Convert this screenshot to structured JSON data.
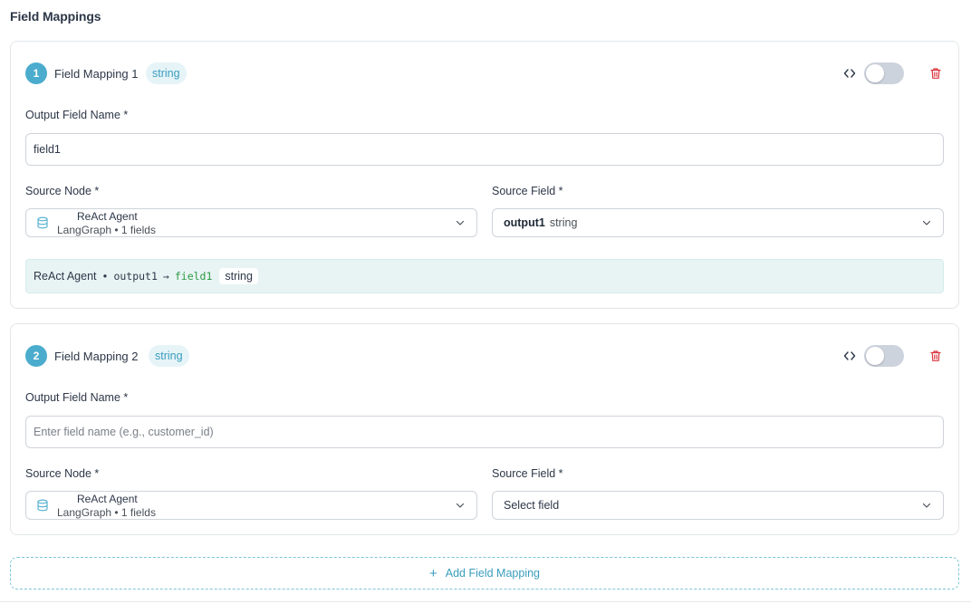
{
  "section": {
    "title": "Field Mappings"
  },
  "mappings": [
    {
      "number": "1",
      "title": "Field Mapping 1",
      "type_badge": "string",
      "output_label": "Output Field Name *",
      "output_value": "field1",
      "output_placeholder": "",
      "source_node_label": "Source Node *",
      "source_node_name": "ReAct Agent",
      "source_node_sub": "LangGraph • 1 fields",
      "source_field_label": "Source Field *",
      "source_field_name": "output1",
      "source_field_type": "string",
      "preview": {
        "node": "ReAct Agent",
        "bullet": "•",
        "output": "output1",
        "arrow": "→",
        "target": "field1",
        "type": "string"
      }
    },
    {
      "number": "2",
      "title": "Field Mapping 2",
      "type_badge": "string",
      "output_label": "Output Field Name *",
      "output_value": "",
      "output_placeholder": "Enter field name (e.g., customer_id)",
      "source_node_label": "Source Node *",
      "source_node_name": "ReAct Agent",
      "source_node_sub": "LangGraph • 1 fields",
      "source_field_label": "Source Field *",
      "source_field_placeholder": "Select field"
    }
  ],
  "add_button": {
    "icon": "plus-icon",
    "label": "Add Field Mapping"
  },
  "icons": {
    "code": "code-icon",
    "trash": "trash-icon",
    "database": "database-icon",
    "chevron": "chevron-down-icon"
  },
  "colors": {
    "accent": "#4baccd",
    "badge_bg": "#e6f4f8",
    "danger": "#d9363e",
    "preview_bg": "#e8f4f4",
    "target_green": "#2e9a44"
  }
}
